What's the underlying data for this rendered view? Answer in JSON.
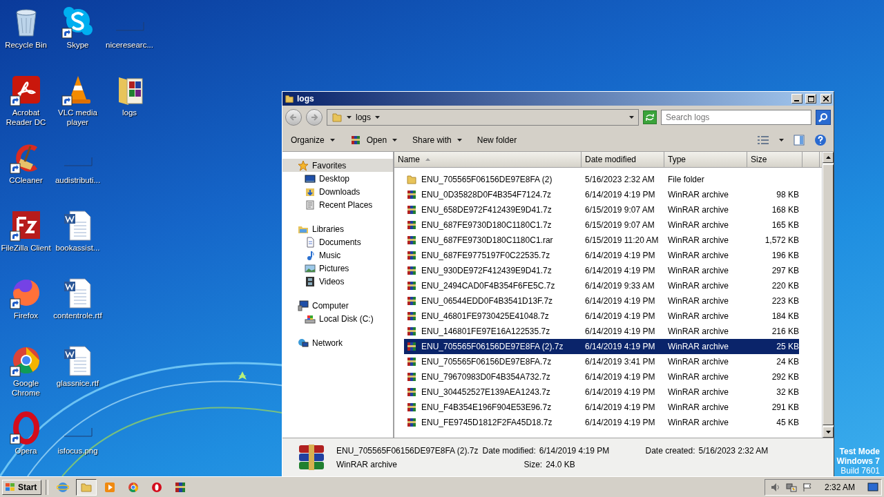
{
  "desktop": {
    "icons": [
      {
        "label": "Recycle Bin",
        "kind": "recycle",
        "shortcut": false
      },
      {
        "label": "Acrobat Reader DC",
        "kind": "acrobat",
        "shortcut": true
      },
      {
        "label": "CCleaner",
        "kind": "ccleaner",
        "shortcut": true
      },
      {
        "label": "FileZilla Client",
        "kind": "filezilla",
        "shortcut": true
      },
      {
        "label": "Firefox",
        "kind": "firefox",
        "shortcut": true
      },
      {
        "label": "Google Chrome",
        "kind": "chrome",
        "shortcut": true
      },
      {
        "label": "Opera",
        "kind": "opera",
        "shortcut": true
      },
      {
        "label": "Skype",
        "kind": "skype",
        "shortcut": true
      },
      {
        "label": "VLC media player",
        "kind": "vlc",
        "shortcut": true
      },
      {
        "label": "audistributi...",
        "kind": "blank",
        "shortcut": false
      },
      {
        "label": "bookassist...",
        "kind": "word",
        "shortcut": false
      },
      {
        "label": "contentrole.rtf",
        "kind": "word",
        "shortcut": false
      },
      {
        "label": "glassnice.rtf",
        "kind": "word",
        "shortcut": false
      },
      {
        "label": "isfocus.png",
        "kind": "blank",
        "shortcut": false
      },
      {
        "label": "niceresearc...",
        "kind": "blank",
        "shortcut": false
      },
      {
        "label": "logs",
        "kind": "rarfolder",
        "shortcut": false
      }
    ],
    "system_info": [
      "Test Mode",
      "Windows 7",
      "Build 7601"
    ]
  },
  "window": {
    "title": "logs",
    "address": {
      "crumbs": [
        "logs"
      ]
    },
    "search": {
      "placeholder": "Search logs"
    },
    "toolbar": [
      {
        "label": "Organize",
        "kind": "menu"
      },
      {
        "label": "Open",
        "kind": "open"
      },
      {
        "label": "Share with",
        "kind": "menu"
      },
      {
        "label": "New folder",
        "kind": "plain"
      }
    ],
    "nav": [
      {
        "label": "Favorites",
        "kind": "star",
        "selected": true,
        "children": [
          {
            "label": "Desktop",
            "kind": "desktop",
            "selected": false
          },
          {
            "label": "Downloads",
            "kind": "downloads",
            "selected": false
          },
          {
            "label": "Recent Places",
            "kind": "recent",
            "selected": false
          }
        ]
      },
      {
        "label": "Libraries",
        "kind": "libraries",
        "selected": false,
        "children": [
          {
            "label": "Documents",
            "kind": "documents",
            "selected": false
          },
          {
            "label": "Music",
            "kind": "music",
            "selected": false
          },
          {
            "label": "Pictures",
            "kind": "pictures",
            "selected": false
          },
          {
            "label": "Videos",
            "kind": "videos",
            "selected": false
          }
        ]
      },
      {
        "label": "Computer",
        "kind": "computer",
        "selected": false,
        "children": [
          {
            "label": "Local Disk (C:)",
            "kind": "disk",
            "selected": false
          }
        ]
      },
      {
        "label": "Network",
        "kind": "network",
        "selected": false
      }
    ],
    "columns": [
      "Name",
      "Date modified",
      "Type",
      "Size"
    ],
    "rows": [
      {
        "name": "ENU_705565F06156DE97E8FA (2)",
        "date": "5/16/2023 2:32 AM",
        "type": "File folder",
        "size": "",
        "kind": "folder",
        "selected": false
      },
      {
        "name": "ENU_0D35828D0F4B354F7124.7z",
        "date": "6/14/2019 4:19 PM",
        "type": "WinRAR archive",
        "size": "98 KB",
        "kind": "archive",
        "selected": false
      },
      {
        "name": "ENU_658DE972F412439E9D41.7z",
        "date": "6/15/2019 9:07 AM",
        "type": "WinRAR archive",
        "size": "168 KB",
        "kind": "archive",
        "selected": false
      },
      {
        "name": "ENU_687FE9730D180C1180C1.7z",
        "date": "6/15/2019 9:07 AM",
        "type": "WinRAR archive",
        "size": "165 KB",
        "kind": "archive",
        "selected": false
      },
      {
        "name": "ENU_687FE9730D180C1180C1.rar",
        "date": "6/15/2019 11:20 AM",
        "type": "WinRAR archive",
        "size": "1,572 KB",
        "kind": "archive",
        "selected": false
      },
      {
        "name": "ENU_687FE9775197F0C22535.7z",
        "date": "6/14/2019 4:19 PM",
        "type": "WinRAR archive",
        "size": "196 KB",
        "kind": "archive",
        "selected": false
      },
      {
        "name": "ENU_930DE972F412439E9D41.7z",
        "date": "6/14/2019 4:19 PM",
        "type": "WinRAR archive",
        "size": "297 KB",
        "kind": "archive",
        "selected": false
      },
      {
        "name": "ENU_2494CAD0F4B354F6FE5C.7z",
        "date": "6/14/2019 9:33 AM",
        "type": "WinRAR archive",
        "size": "220 KB",
        "kind": "archive",
        "selected": false
      },
      {
        "name": "ENU_06544EDD0F4B3541D13F.7z",
        "date": "6/14/2019 4:19 PM",
        "type": "WinRAR archive",
        "size": "223 KB",
        "kind": "archive",
        "selected": false
      },
      {
        "name": "ENU_46801FE9730425E41048.7z",
        "date": "6/14/2019 4:19 PM",
        "type": "WinRAR archive",
        "size": "184 KB",
        "kind": "archive",
        "selected": false
      },
      {
        "name": "ENU_146801FE97E16A122535.7z",
        "date": "6/14/2019 4:19 PM",
        "type": "WinRAR archive",
        "size": "216 KB",
        "kind": "archive",
        "selected": false
      },
      {
        "name": "ENU_705565F06156DE97E8FA (2).7z",
        "date": "6/14/2019 4:19 PM",
        "type": "WinRAR archive",
        "size": "25 KB",
        "kind": "archive",
        "selected": true
      },
      {
        "name": "ENU_705565F06156DE97E8FA.7z",
        "date": "6/14/2019 3:41 PM",
        "type": "WinRAR archive",
        "size": "24 KB",
        "kind": "archive",
        "selected": false
      },
      {
        "name": "ENU_79670983D0F4B354A732.7z",
        "date": "6/14/2019 4:19 PM",
        "type": "WinRAR archive",
        "size": "292 KB",
        "kind": "archive",
        "selected": false
      },
      {
        "name": "ENU_304452527E139AEA1243.7z",
        "date": "6/14/2019 4:19 PM",
        "type": "WinRAR archive",
        "size": "32 KB",
        "kind": "archive",
        "selected": false
      },
      {
        "name": "ENU_F4B354E196F904E53E96.7z",
        "date": "6/14/2019 4:19 PM",
        "type": "WinRAR archive",
        "size": "291 KB",
        "kind": "archive",
        "selected": false
      },
      {
        "name": "ENU_FE9745D1812F2FA45D18.7z",
        "date": "6/14/2019 4:19 PM",
        "type": "WinRAR archive",
        "size": "45 KB",
        "kind": "archive",
        "selected": false
      }
    ],
    "details": {
      "name": "ENU_705565F06156DE97E8FA (2).7z",
      "type": "WinRAR archive",
      "modified_label": "Date modified:",
      "modified": "6/14/2019 4:19 PM",
      "created_label": "Date created:",
      "created": "5/16/2023 2:32 AM",
      "size_label": "Size:",
      "size": "24.0 KB"
    }
  },
  "taskbar": {
    "start": "Start",
    "apps": [
      {
        "kind": "ie",
        "active": false
      },
      {
        "kind": "explorer",
        "active": true
      },
      {
        "kind": "media",
        "active": false
      },
      {
        "kind": "chrome",
        "active": false
      },
      {
        "kind": "opera",
        "active": false
      },
      {
        "kind": "winrar",
        "active": false
      }
    ],
    "clock": "2:32 AM"
  }
}
